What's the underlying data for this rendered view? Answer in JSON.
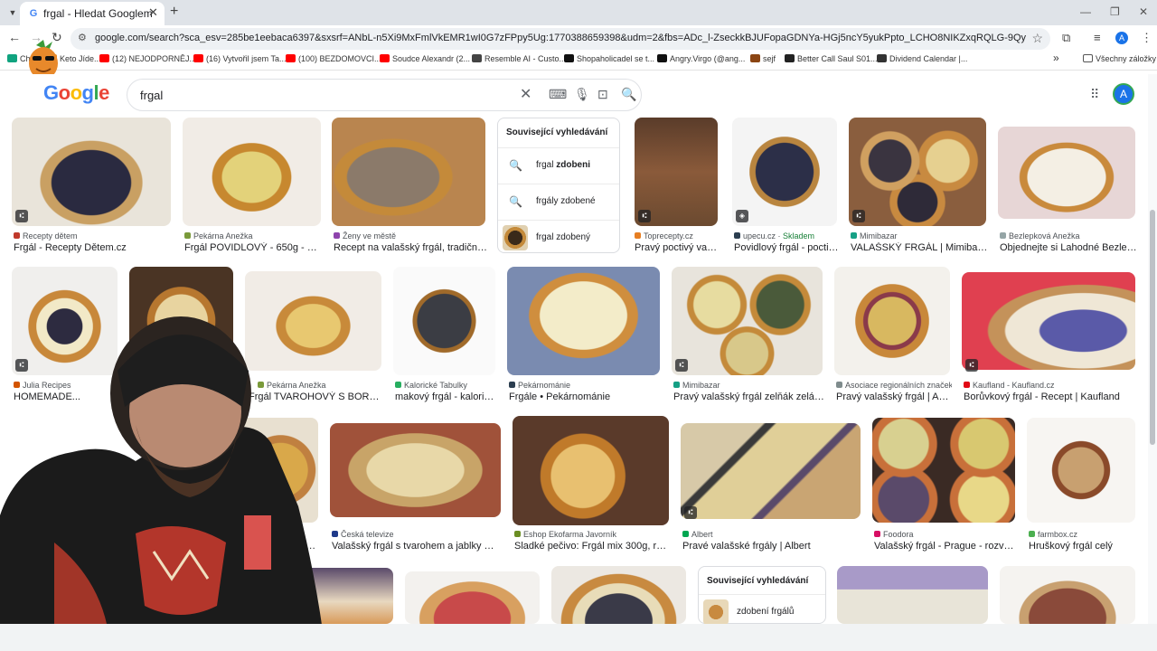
{
  "browser": {
    "tab_title": "frgal - Hledat Googlem",
    "url": "google.com/search?sca_esv=285be1eebaca6397&sxsrf=ANbL-n5Xi9MxFmlVkEMR1wI0G7zFPpy5Ug:1770388659398&udm=2&fbs=ADc_l-ZseckkBJUFopaGDNYa-HGj5ncY5yukPpto_LCHO8NIKZxqRQLG-9QyqhD10rwOrsKp4TdvrOmGY3kJMlwR26Y0tN...",
    "profile_initial": "A",
    "bookmarks": [
      {
        "label": "Chat",
        "color": "#10a37f"
      },
      {
        "label": "Keto Jíde...",
        "color": "#e88a2a"
      },
      {
        "label": "(12) NEJODPORNĚJ...",
        "color": "#ff0000"
      },
      {
        "label": "(16) Vytvořil jsem Ta...",
        "color": "#ff0000"
      },
      {
        "label": "(100) BEZDOMOVCI...",
        "color": "#ff0000"
      },
      {
        "label": "Soudce Alexandr (2...",
        "color": "#ff0000"
      },
      {
        "label": "Resemble AI - Custo...",
        "color": "#444444"
      },
      {
        "label": "Shopaholicadel se t...",
        "color": "#111111"
      },
      {
        "label": "Angry.Virgo (@ang...",
        "color": "#111111"
      },
      {
        "label": "sejf",
        "color": "#8b4513"
      },
      {
        "label": "Better Call Saul S01...",
        "color": "#222222"
      },
      {
        "label": "Dividend Calendar |...",
        "color": "#333333"
      }
    ],
    "bookmarks_more": "»",
    "all_bookmarks": "Všechny záložky"
  },
  "google": {
    "logo": "Google",
    "query": "frgal"
  },
  "related_top": {
    "heading": "Související vyhledávání",
    "items": [
      {
        "plain": "frgal ",
        "bold": "zdobeni",
        "icon": "search-icon"
      },
      {
        "plain": "frgály zdobené",
        "bold": "",
        "icon": "search-icon"
      },
      {
        "plain": "frgal zdobený",
        "bold": "",
        "icon": "thumbnail"
      }
    ]
  },
  "related_bottom": {
    "heading": "Související vyhledávání",
    "items": [
      {
        "plain": "zdobení frgálů",
        "bold": ""
      }
    ]
  },
  "results": [
    {
      "source": "Recepty dětem",
      "title": "Frgál - Recepty Dětem.cz",
      "src_color": "#c0392b",
      "badge": true
    },
    {
      "source": "Pekárna Anežka",
      "title": "Frgál POVIDLOVÝ - 650g - Val...",
      "src_color": "#7a9a3a",
      "badge": false
    },
    {
      "source": "Ženy ve městě",
      "title": "Recept na valašský frgál, tradiční vá...",
      "src_color": "#8e44ad",
      "badge": false
    },
    {
      "source": "Toprecepty.cz",
      "title": "Pravý poctivý vala...",
      "src_color": "#e67e22",
      "badge": true
    },
    {
      "source": "upecu.cz",
      "stock": "Skladem",
      "title": "Povidlový frgál - poctivá...",
      "src_color": "#2c3e50",
      "badge": true
    },
    {
      "source": "Mimibazar",
      "title": "VALAŠSKÝ FRGÁL | Mimibazar....",
      "src_color": "#16a085",
      "badge": true
    },
    {
      "source": "Bezlepková Anežka",
      "title": "Objednejte si Lahodné Bezlepk...",
      "src_color": "#95a5a6",
      "badge": false
    },
    {
      "source": "Julia Recipes",
      "title": "HOMEMADE...",
      "src_color": "#d35400",
      "badge": true
    },
    {
      "source": "Pekárna Anežka",
      "title": "Frgál TVAROHOVÝ S BORŮVK...",
      "src_color": "#7a9a3a",
      "badge": false
    },
    {
      "source": "Kalorické Tabulky",
      "title": "makový frgál - kalorie, ...",
      "src_color": "#27ae60",
      "badge": false
    },
    {
      "source": "Pekárnománie",
      "title": "Frgále • Pekárnománie",
      "src_color": "#2c3e50",
      "badge": false
    },
    {
      "source": "Mimibazar",
      "title": "Pravý valašský frgál zelňák zelák | ...",
      "src_color": "#16a085",
      "badge": true
    },
    {
      "source": "Asociace regionálních značek",
      "title": "Pravý valašský frgál | Aso...",
      "src_color": "#7f8c8d",
      "badge": false
    },
    {
      "source": "Kaufland - Kaufland.cz",
      "title": "Borůvkový frgál - Recept | Kaufland",
      "src_color": "#e10915",
      "badge": true
    },
    {
      "source": "",
      "title": "...plní ze suše...",
      "src_color": "#999999",
      "badge": false
    },
    {
      "source": "Česká televize",
      "title": "Valašský frgál s tvarohem a jablky — Ku...",
      "src_color": "#1e3a8a",
      "badge": false
    },
    {
      "source": "Eshop Ekofarma Javorník",
      "title": "Sladké pečivo: Frgál mix 300g, různ...",
      "src_color": "#6b8e23",
      "badge": false
    },
    {
      "source": "Albert",
      "title": "Pravé valašské frgály | Albert",
      "src_color": "#00a651",
      "badge": true
    },
    {
      "source": "Foodora",
      "title": "Valašský frgál - Prague - rozvoz j...",
      "src_color": "#d70f64",
      "badge": false
    },
    {
      "source": "farmbox.cz",
      "title": "Hruškový frgál celý",
      "src_color": "#4caf50",
      "badge": false
    }
  ],
  "colors": {
    "google_blue": "#4285f4",
    "google_red": "#ea4335",
    "google_yellow": "#fbbc05",
    "google_green": "#34a853"
  }
}
